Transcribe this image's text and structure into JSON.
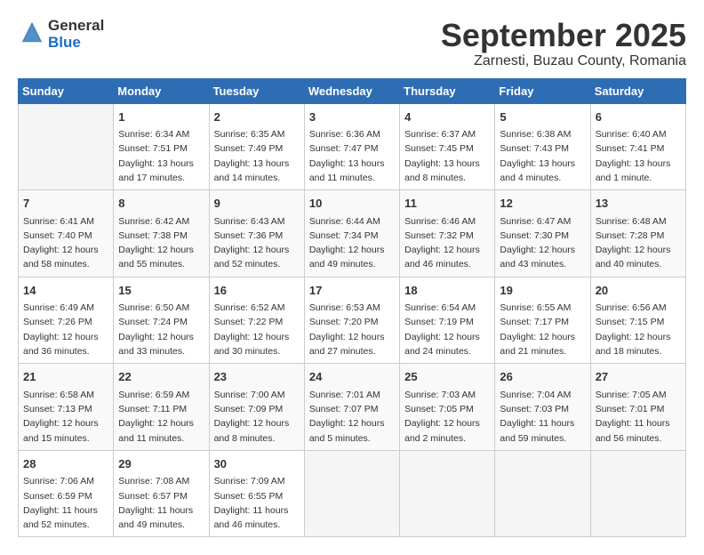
{
  "header": {
    "logo_general": "General",
    "logo_blue": "Blue",
    "month": "September 2025",
    "location": "Zarnesti, Buzau County, Romania"
  },
  "weekdays": [
    "Sunday",
    "Monday",
    "Tuesday",
    "Wednesday",
    "Thursday",
    "Friday",
    "Saturday"
  ],
  "weeks": [
    [
      {
        "day": "",
        "info": ""
      },
      {
        "day": "1",
        "info": "Sunrise: 6:34 AM\nSunset: 7:51 PM\nDaylight: 13 hours\nand 17 minutes."
      },
      {
        "day": "2",
        "info": "Sunrise: 6:35 AM\nSunset: 7:49 PM\nDaylight: 13 hours\nand 14 minutes."
      },
      {
        "day": "3",
        "info": "Sunrise: 6:36 AM\nSunset: 7:47 PM\nDaylight: 13 hours\nand 11 minutes."
      },
      {
        "day": "4",
        "info": "Sunrise: 6:37 AM\nSunset: 7:45 PM\nDaylight: 13 hours\nand 8 minutes."
      },
      {
        "day": "5",
        "info": "Sunrise: 6:38 AM\nSunset: 7:43 PM\nDaylight: 13 hours\nand 4 minutes."
      },
      {
        "day": "6",
        "info": "Sunrise: 6:40 AM\nSunset: 7:41 PM\nDaylight: 13 hours\nand 1 minute."
      }
    ],
    [
      {
        "day": "7",
        "info": "Sunrise: 6:41 AM\nSunset: 7:40 PM\nDaylight: 12 hours\nand 58 minutes."
      },
      {
        "day": "8",
        "info": "Sunrise: 6:42 AM\nSunset: 7:38 PM\nDaylight: 12 hours\nand 55 minutes."
      },
      {
        "day": "9",
        "info": "Sunrise: 6:43 AM\nSunset: 7:36 PM\nDaylight: 12 hours\nand 52 minutes."
      },
      {
        "day": "10",
        "info": "Sunrise: 6:44 AM\nSunset: 7:34 PM\nDaylight: 12 hours\nand 49 minutes."
      },
      {
        "day": "11",
        "info": "Sunrise: 6:46 AM\nSunset: 7:32 PM\nDaylight: 12 hours\nand 46 minutes."
      },
      {
        "day": "12",
        "info": "Sunrise: 6:47 AM\nSunset: 7:30 PM\nDaylight: 12 hours\nand 43 minutes."
      },
      {
        "day": "13",
        "info": "Sunrise: 6:48 AM\nSunset: 7:28 PM\nDaylight: 12 hours\nand 40 minutes."
      }
    ],
    [
      {
        "day": "14",
        "info": "Sunrise: 6:49 AM\nSunset: 7:26 PM\nDaylight: 12 hours\nand 36 minutes."
      },
      {
        "day": "15",
        "info": "Sunrise: 6:50 AM\nSunset: 7:24 PM\nDaylight: 12 hours\nand 33 minutes."
      },
      {
        "day": "16",
        "info": "Sunrise: 6:52 AM\nSunset: 7:22 PM\nDaylight: 12 hours\nand 30 minutes."
      },
      {
        "day": "17",
        "info": "Sunrise: 6:53 AM\nSunset: 7:20 PM\nDaylight: 12 hours\nand 27 minutes."
      },
      {
        "day": "18",
        "info": "Sunrise: 6:54 AM\nSunset: 7:19 PM\nDaylight: 12 hours\nand 24 minutes."
      },
      {
        "day": "19",
        "info": "Sunrise: 6:55 AM\nSunset: 7:17 PM\nDaylight: 12 hours\nand 21 minutes."
      },
      {
        "day": "20",
        "info": "Sunrise: 6:56 AM\nSunset: 7:15 PM\nDaylight: 12 hours\nand 18 minutes."
      }
    ],
    [
      {
        "day": "21",
        "info": "Sunrise: 6:58 AM\nSunset: 7:13 PM\nDaylight: 12 hours\nand 15 minutes."
      },
      {
        "day": "22",
        "info": "Sunrise: 6:59 AM\nSunset: 7:11 PM\nDaylight: 12 hours\nand 11 minutes."
      },
      {
        "day": "23",
        "info": "Sunrise: 7:00 AM\nSunset: 7:09 PM\nDaylight: 12 hours\nand 8 minutes."
      },
      {
        "day": "24",
        "info": "Sunrise: 7:01 AM\nSunset: 7:07 PM\nDaylight: 12 hours\nand 5 minutes."
      },
      {
        "day": "25",
        "info": "Sunrise: 7:03 AM\nSunset: 7:05 PM\nDaylight: 12 hours\nand 2 minutes."
      },
      {
        "day": "26",
        "info": "Sunrise: 7:04 AM\nSunset: 7:03 PM\nDaylight: 11 hours\nand 59 minutes."
      },
      {
        "day": "27",
        "info": "Sunrise: 7:05 AM\nSunset: 7:01 PM\nDaylight: 11 hours\nand 56 minutes."
      }
    ],
    [
      {
        "day": "28",
        "info": "Sunrise: 7:06 AM\nSunset: 6:59 PM\nDaylight: 11 hours\nand 52 minutes."
      },
      {
        "day": "29",
        "info": "Sunrise: 7:08 AM\nSunset: 6:57 PM\nDaylight: 11 hours\nand 49 minutes."
      },
      {
        "day": "30",
        "info": "Sunrise: 7:09 AM\nSunset: 6:55 PM\nDaylight: 11 hours\nand 46 minutes."
      },
      {
        "day": "",
        "info": ""
      },
      {
        "day": "",
        "info": ""
      },
      {
        "day": "",
        "info": ""
      },
      {
        "day": "",
        "info": ""
      }
    ]
  ]
}
